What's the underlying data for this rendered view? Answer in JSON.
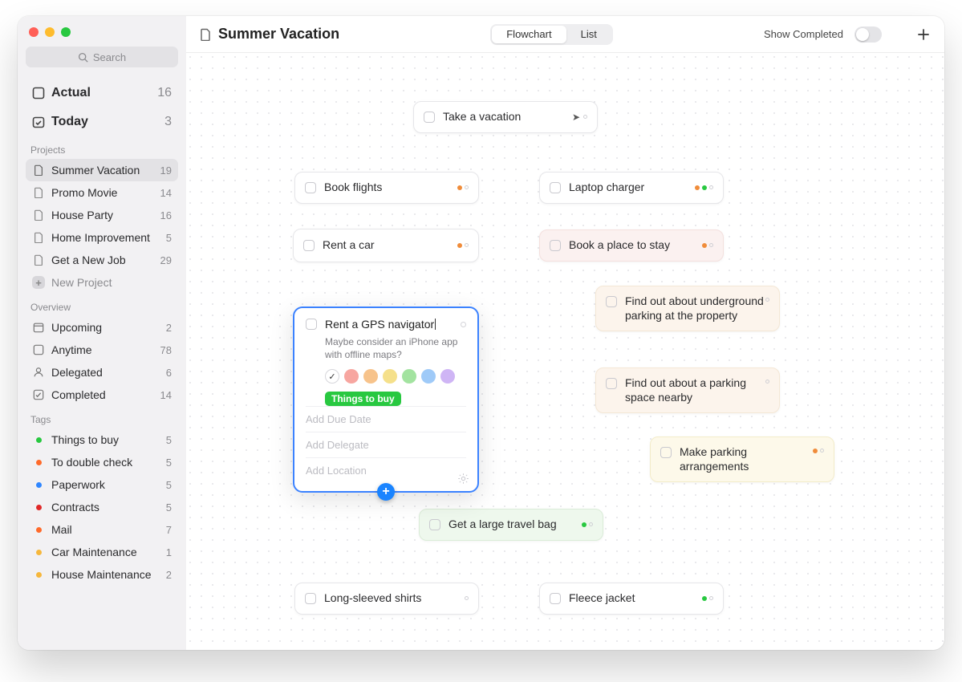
{
  "window": {
    "title": "Summer Vacation"
  },
  "sidebar": {
    "search_placeholder": "Search",
    "quick": [
      {
        "label": "Actual",
        "count": "16"
      },
      {
        "label": "Today",
        "count": "3"
      }
    ],
    "projects_header": "Projects",
    "projects": [
      {
        "label": "Summer Vacation",
        "count": "19",
        "active": true
      },
      {
        "label": "Promo Movie",
        "count": "14"
      },
      {
        "label": "House Party",
        "count": "16"
      },
      {
        "label": "Home Improvement",
        "count": "5"
      },
      {
        "label": "Get a New Job",
        "count": "29"
      }
    ],
    "new_project": "New Project",
    "overview_header": "Overview",
    "overview": [
      {
        "label": "Upcoming",
        "count": "2"
      },
      {
        "label": "Anytime",
        "count": "78"
      },
      {
        "label": "Delegated",
        "count": "6"
      },
      {
        "label": "Completed",
        "count": "14"
      }
    ],
    "tags_header": "Tags",
    "tags": [
      {
        "label": "Things to buy",
        "count": "5",
        "color": "#28c840"
      },
      {
        "label": "To double check",
        "count": "5",
        "color": "#ff6a2a"
      },
      {
        "label": "Paperwork",
        "count": "5",
        "color": "#2f86ff"
      },
      {
        "label": "Contracts",
        "count": "5",
        "color": "#e02828"
      },
      {
        "label": "Mail",
        "count": "7",
        "color": "#ff6a2a"
      },
      {
        "label": "Car Maintenance",
        "count": "1",
        "color": "#f6b73c"
      },
      {
        "label": "House Maintenance",
        "count": "2",
        "color": "#f6b73c"
      }
    ]
  },
  "topbar": {
    "view_flowchart": "Flowchart",
    "view_list": "List",
    "show_completed": "Show Completed"
  },
  "nodes": {
    "root": {
      "text": "Take a vacation"
    },
    "book_flights": {
      "text": "Book flights"
    },
    "laptop_charger": {
      "text": "Laptop charger"
    },
    "rent_car": {
      "text": "Rent a car"
    },
    "book_place": {
      "text": "Book a place to stay"
    },
    "underground": {
      "text": "Find out about underground parking at the property"
    },
    "nearby": {
      "text": "Find out about a parking space nearby"
    },
    "parking": {
      "text": "Make parking arrangements"
    },
    "travel_bag": {
      "text": "Get a large travel bag"
    },
    "shirts": {
      "text": "Long-sleeved shirts"
    },
    "fleece": {
      "text": "Fleece jacket"
    }
  },
  "card": {
    "title": "Rent a GPS navigator",
    "note": "Maybe consider an iPhone app with offline maps?",
    "tag": "Things to buy",
    "colors": [
      "none",
      "#f7a6a0",
      "#f7c38b",
      "#f5e08b",
      "#a3e3a0",
      "#9fcaf8",
      "#cfb5f5"
    ],
    "fields": {
      "due": "Add Due Date",
      "delegate": "Add Delegate",
      "location": "Add Location"
    }
  },
  "palette": {
    "orange": "#f08c3a",
    "green": "#28c840",
    "red": "#e85b48"
  }
}
